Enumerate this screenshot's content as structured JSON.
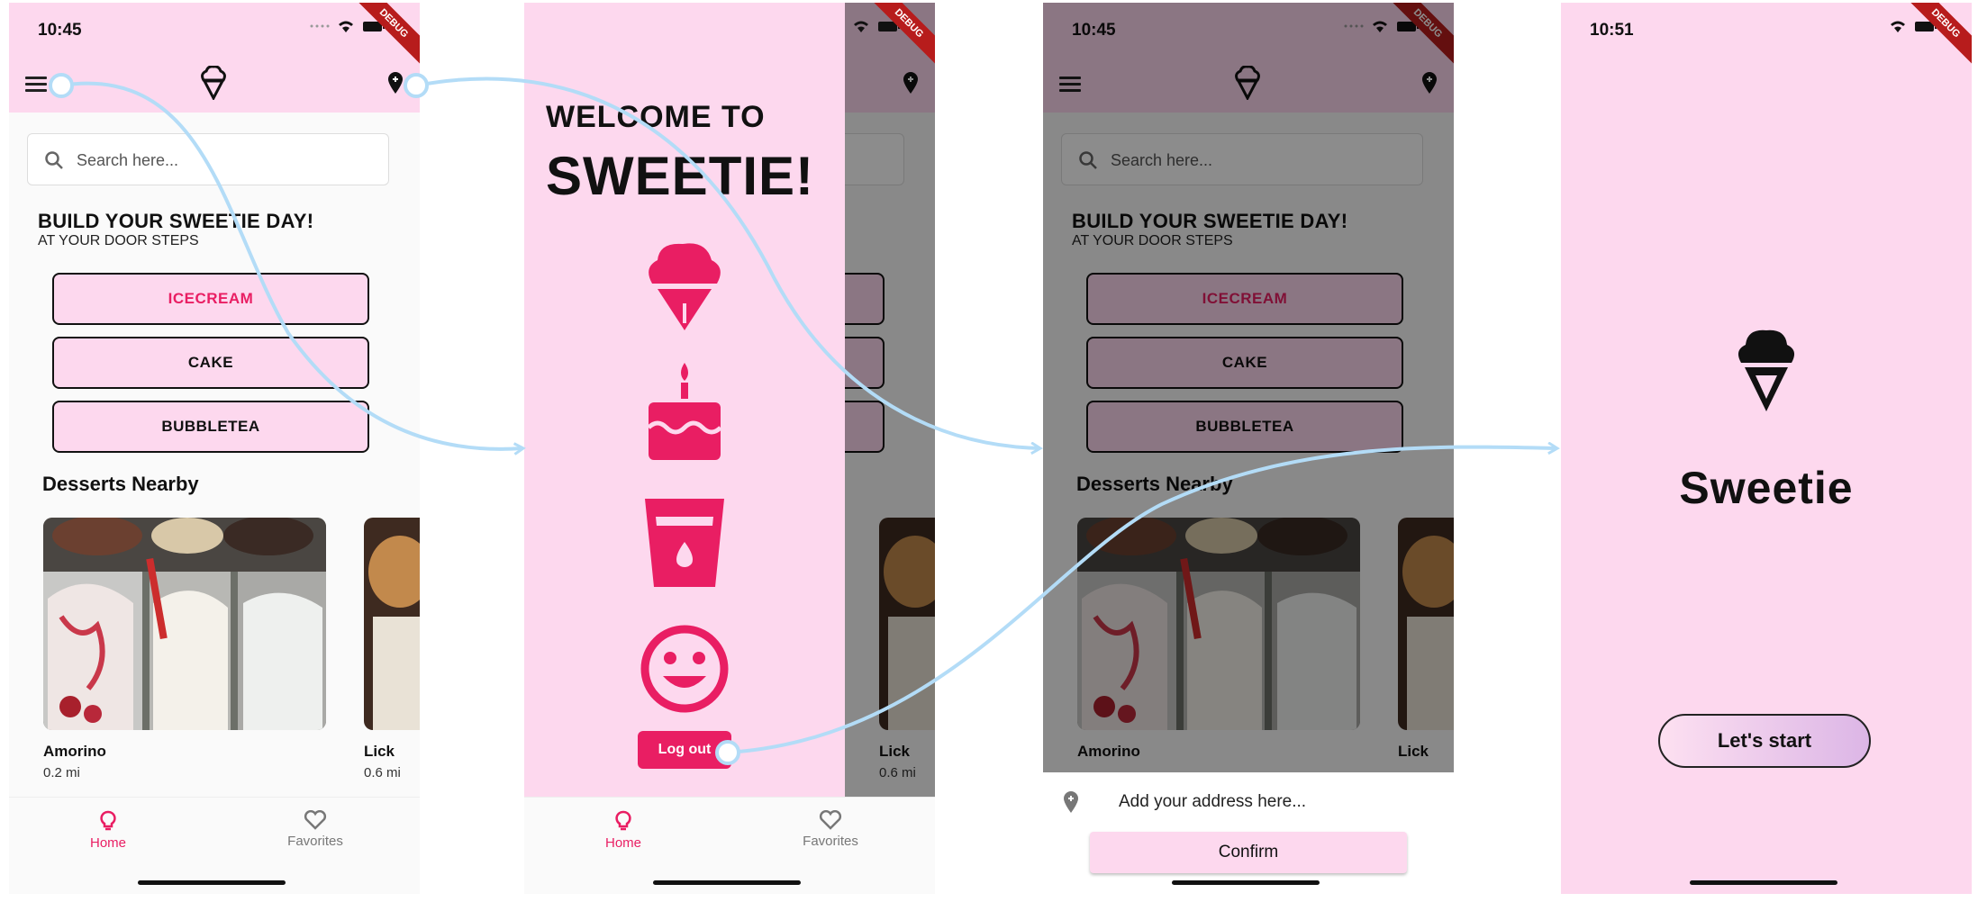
{
  "status": {
    "time_main": "10:45",
    "time_splash": "10:51",
    "debug_label": "DEBUG"
  },
  "search": {
    "placeholder": "Search here..."
  },
  "home": {
    "headline": "BUILD YOUR SWEETIE DAY!",
    "subline": "AT YOUR DOOR STEPS",
    "categories": [
      {
        "label": "ICECREAM",
        "active": true
      },
      {
        "label": "CAKE",
        "active": false
      },
      {
        "label": "BUBBLETEA",
        "active": false
      }
    ],
    "nearby_title": "Desserts Nearby",
    "shops": [
      {
        "name": "Amorino",
        "distance": "0.2 mi"
      },
      {
        "name": "Lick",
        "distance": "0.6 mi"
      }
    ]
  },
  "nav": {
    "home": "Home",
    "favorites": "Favorites"
  },
  "drawer": {
    "welcome_line1": "WELCOME TO",
    "welcome_line2": "SWEETIE!",
    "menu_icons": [
      "icecream-icon",
      "cake-icon",
      "bubbletea-icon",
      "smiley-icon"
    ],
    "logout_label": "Log out"
  },
  "address_sheet": {
    "placeholder": "Add your address here...",
    "confirm_label": "Confirm"
  },
  "splash": {
    "title": "Sweetie",
    "start_label": "Let's start"
  },
  "colors": {
    "pink_bg": "#fdd8ee",
    "accent": "#e91e63",
    "flow_arrow": "#b3dcf7"
  }
}
